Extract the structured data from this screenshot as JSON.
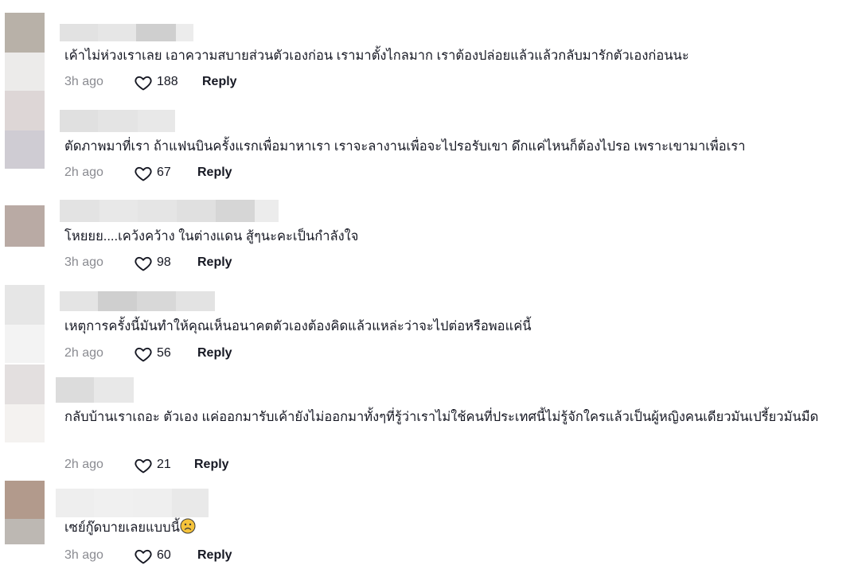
{
  "comments": [
    {
      "text": "เค้าไม่ห่วงเราเลย เอาความสบายส่วนตัวเองก่อน เรามาตั้งไกลมาก เราต้องปล่อยแล้วแล้วกลับมารักตัวเองก่อนนะ",
      "time": "3h ago",
      "likes": "188",
      "reply": "Reply"
    },
    {
      "text": "ตัดภาพมาที่เรา ถ้าแฟนบินครั้งแรกเพื่อมาหาเรา เราจะลางานเพื่อจะไปรอรับเขา ดึกแค่ไหนก็ต้องไปรอ เพราะเขามาเพื่อเรา",
      "time": "2h ago",
      "likes": "67",
      "reply": "Reply"
    },
    {
      "text": "โหยยย....เคว้งคว้าง ในต่างแดน สู้ๆนะคะเป็นกำลังใจ",
      "time": "3h ago",
      "likes": "98",
      "reply": "Reply"
    },
    {
      "text": "เหตุการครั้งนี้มันทำให้คุณเห็นอนาคตตัวเองต้องคิดแล้วแหล่ะว่าจะไปต่อหรือพอแค่นี้",
      "time": "2h ago",
      "likes": "56",
      "reply": "Reply"
    },
    {
      "text": "กลับบ้านเราเถอะ ตัวเอง แค่ออกมารับเค้ายังไม่ออกมาทั้งๆที่รู้ว่าเราไม่ใช้คนที่ประเทศนี้ไม่รู้จักใครแล้วเป็นผู้หญิงคนเดียวมันเปรี้ยวมันมืด",
      "time": "2h ago",
      "likes": "21",
      "reply": "Reply"
    },
    {
      "text": "เซย์กู๊ดบายเลยแบบนี้",
      "emoji": "sad-face-emoji",
      "time": "3h ago",
      "likes": "60",
      "reply": "Reply"
    }
  ],
  "icons": {
    "like": "heart-outline-icon"
  },
  "colors": {
    "text": "#161823",
    "muted": "#8a8b91",
    "background": "#ffffff"
  }
}
